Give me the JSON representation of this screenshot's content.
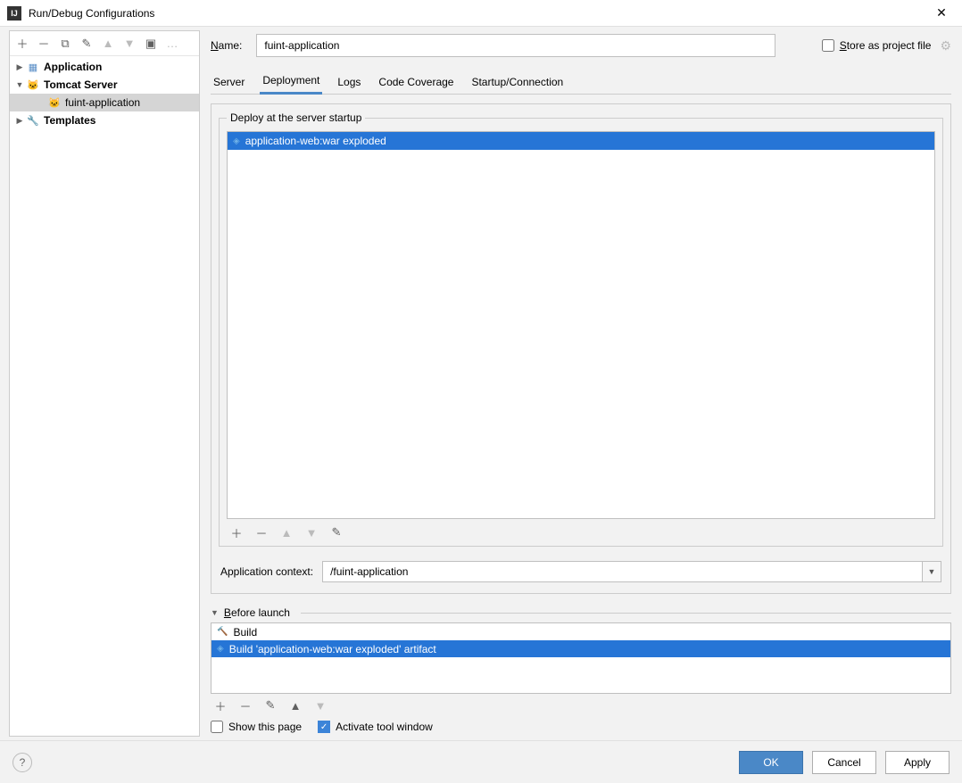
{
  "window": {
    "title": "Run/Debug Configurations"
  },
  "nameRow": {
    "label": "Name:",
    "labelUnderline": "N",
    "value": "fuint-application",
    "storeAs": "Store as project file",
    "storeUnderline": "S"
  },
  "tree": {
    "application": "Application",
    "tomcat": "Tomcat Server",
    "fuintApp": "fuint-application",
    "templates": "Templates"
  },
  "tabs": {
    "server": "Server",
    "deployment": "Deployment",
    "logs": "Logs",
    "codeCoverage": "Code Coverage",
    "startup": "Startup/Connection"
  },
  "deploy": {
    "legend": "Deploy at the server startup",
    "item": "application-web:war exploded"
  },
  "context": {
    "label": "Application context:",
    "value": "/fuint-application"
  },
  "beforeLaunch": {
    "header": "Before launch",
    "headerUnderline": "B",
    "build": "Build",
    "buildArtifact": "Build 'application-web:war exploded' artifact"
  },
  "checks": {
    "showPage": "Show this page",
    "activate": "Activate tool window"
  },
  "footer": {
    "ok": "OK",
    "cancel": "Cancel",
    "apply": "Apply"
  }
}
